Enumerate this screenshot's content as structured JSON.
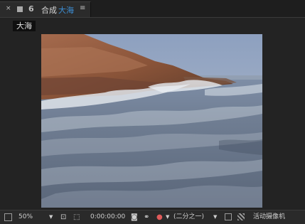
{
  "tab": {
    "close_glyph": "×",
    "lock_glyph": "6",
    "prefix": "合成",
    "name": "大海",
    "menu_glyph": "≡"
  },
  "breadcrumb": {
    "label": "大海"
  },
  "toolbar": {
    "zoom": "50%",
    "dropdown_glyph": "▼",
    "timecode": "0:00:00:00",
    "resolution": "(二分之一)",
    "camera": "活动摄像机"
  },
  "colors": {
    "accent": "#3d8fd6",
    "panel_bg": "#232323",
    "toolbar_bg": "#2a2a2a"
  }
}
